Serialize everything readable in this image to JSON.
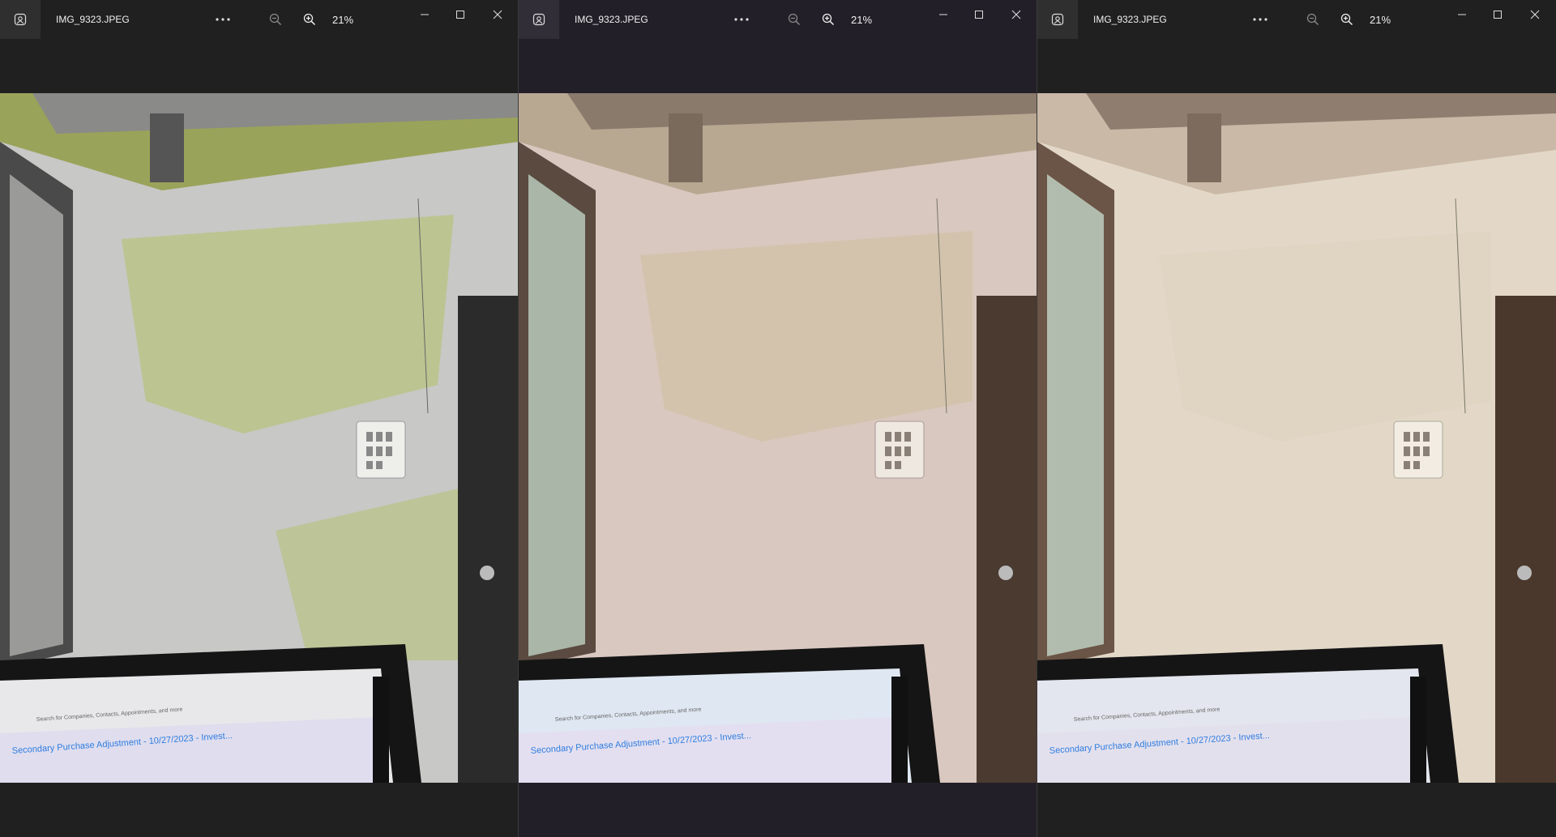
{
  "windows": [
    {
      "file_name": "IMG_9323.JPEG",
      "zoom": "21%",
      "variant": "posterized",
      "colors": {
        "wall": "#c8c8c6",
        "wall_tint": "#b6c27a",
        "ceiling": "#9aa35a",
        "door": "#2b2b2b",
        "frame": "#4a4a4a",
        "bg": "#202020"
      }
    },
    {
      "file_name": "IMG_9323.JPEG",
      "zoom": "21%",
      "variant": "warm",
      "colors": {
        "wall": "#d9c8bf",
        "wall_tint": "#cdbf9e",
        "ceiling": "#b8a892",
        "door": "#4a3a30",
        "frame": "#5a4a40",
        "bg": "#231f28"
      }
    },
    {
      "file_name": "IMG_9323.JPEG",
      "zoom": "21%",
      "variant": "original",
      "colors": {
        "wall": "#e3d8c8",
        "wall_tint": "#ddd0bb",
        "ceiling": "#c9b9a6",
        "door": "#4b382c",
        "frame": "#6b5546",
        "bg": "#202020"
      }
    }
  ],
  "laptop_screen_text": {
    "heading": "Secondary Purchase Adjustment - 10/27/2023 - Invest...",
    "search": "Search for Companies, Contacts, Appointments, and more"
  },
  "accent": "#2f7de0"
}
